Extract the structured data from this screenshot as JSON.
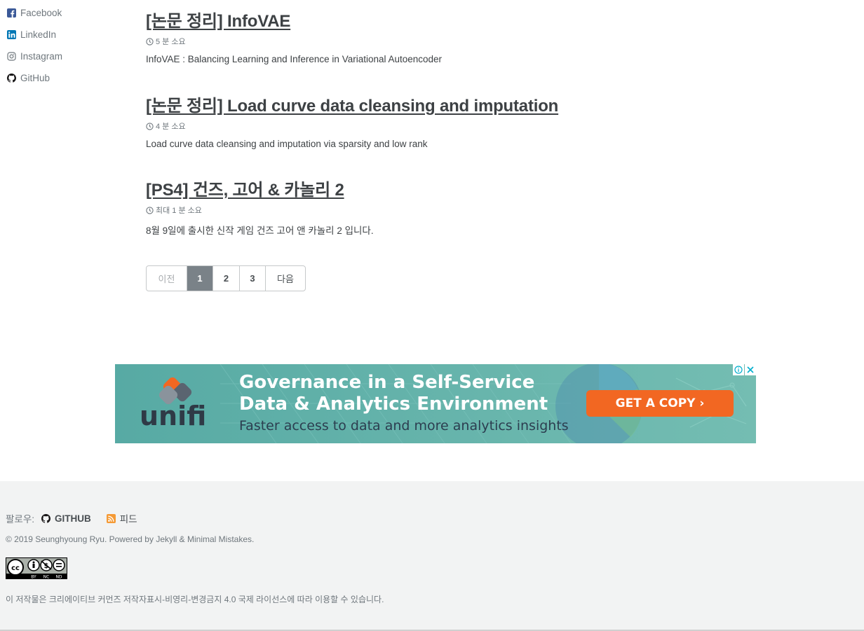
{
  "sidebar": {
    "links": [
      {
        "label": "Facebook",
        "icon": "facebook-icon"
      },
      {
        "label": "LinkedIn",
        "icon": "linkedin-icon"
      },
      {
        "label": "Instagram",
        "icon": "instagram-icon"
      },
      {
        "label": "GitHub",
        "icon": "github-icon"
      }
    ]
  },
  "posts": [
    {
      "title": "[논문 정리] InfoVAE",
      "meta": "5 분 소요",
      "excerpt": "InfoVAE : Balancing Learning and Inference in Variational Autoencoder"
    },
    {
      "title": "[논문 정리] Load curve data cleansing and imputation",
      "meta": "4 분 소요",
      "excerpt": "Load curve data cleansing and imputation via sparsity and low rank"
    },
    {
      "title": "[PS4] 건즈, 고어 & 카놀리 2",
      "meta": "최대 1 분 소요",
      "excerpt": "8월 9일에 출시한 신작 게임 건즈 고어 앤 카놀리 2 입니다."
    }
  ],
  "pagination": {
    "prev": "이전",
    "pages": [
      "1",
      "2",
      "3"
    ],
    "current": "1",
    "next": "다음"
  },
  "ad": {
    "brand": "unifi",
    "headline_line1": "Governance in a Self-Service",
    "headline_line2": "Data & Analytics Environment",
    "subline": "Faster access to data and more analytics insights",
    "cta": "GET A COPY ›",
    "colors": {
      "background": "#5fb3ad",
      "cta": "#f26722",
      "brand_text": "#2f3a46"
    }
  },
  "footer": {
    "follow_label": "팔로우:",
    "github_label": "GITHUB",
    "feed_label": "피드",
    "copyright": "© 2019 Seunghyoung Ryu. Powered by Jekyll & Minimal Mistakes.",
    "license_text": "이 저작물은 크리에이티브 커먼즈 저작자표시-비영리-변경금지 4.0 국제 라이선스에 따라 이용할 수 있습니다.",
    "cc_badge_labels": [
      "BY",
      "NC",
      "ND"
    ]
  }
}
